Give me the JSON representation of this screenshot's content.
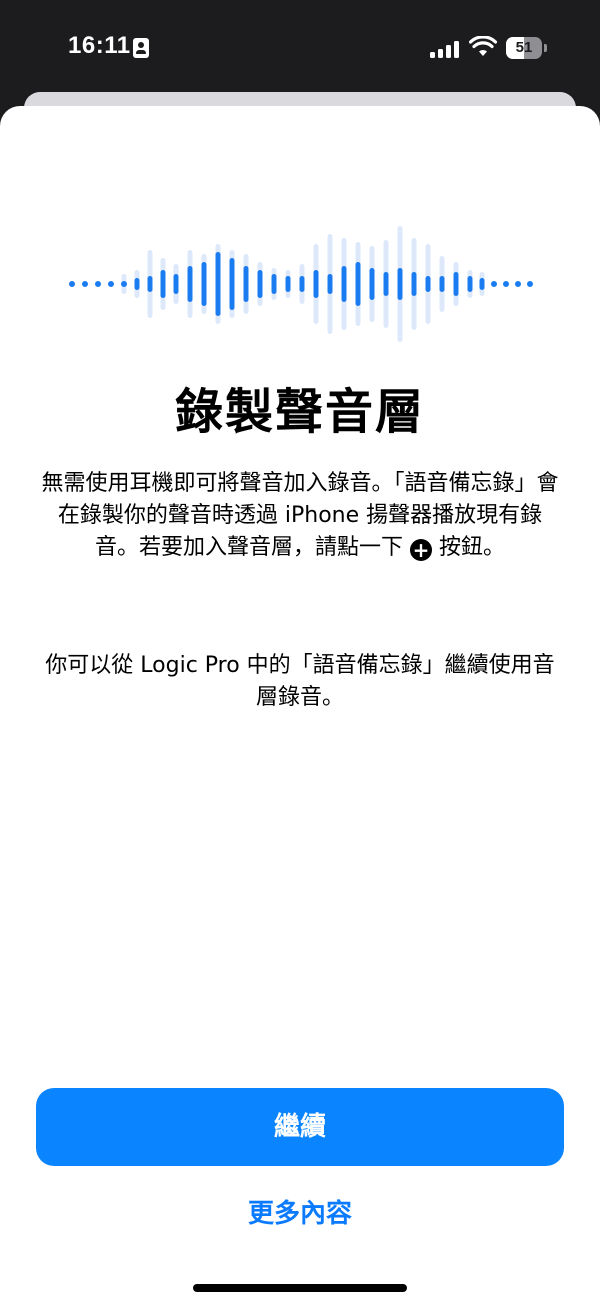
{
  "status_bar": {
    "time": "16:11",
    "battery_percent": "51",
    "battery_level": 0.51,
    "signal_bars": 4,
    "icons": [
      "contact-card-icon",
      "cellular-signal-icon",
      "wifi-icon",
      "battery-icon"
    ]
  },
  "onboarding": {
    "illustration": "waveform-icon",
    "title": "錄製聲音層",
    "paragraph1_part1": "無需使用耳機即可將聲音加入錄音。「語音備忘錄」會在錄製你的聲音時透過 iPhone 揚聲器播放現有錄音。若要加入聲音層，請點一下",
    "paragraph1_part2": "按鈕。",
    "plus_icon_glyph": "+",
    "paragraph2": "你可以從 Logic Pro 中的「語音備忘錄」繼續使用音層錄音。"
  },
  "actions": {
    "continue_label": "繼續",
    "more_label": "更多內容"
  },
  "colors": {
    "accent": "#0a84ff",
    "link": "#0a7aff",
    "waveform_active": "#1a7cf0",
    "waveform_faded": "#dde9fb"
  }
}
